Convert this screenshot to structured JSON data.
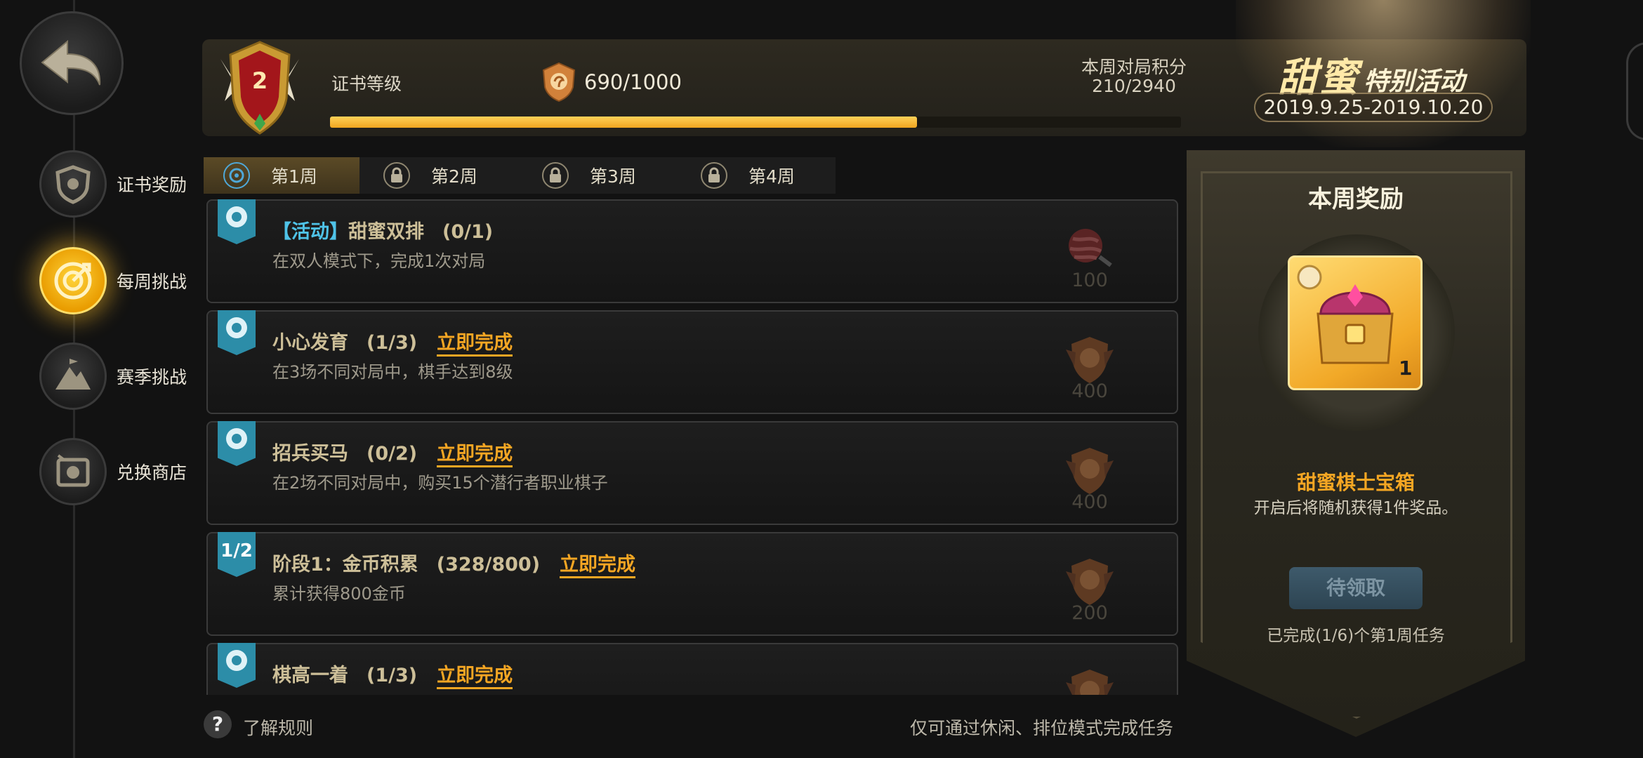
{
  "nav": {
    "items": [
      {
        "label": "证书奖励",
        "icon": "shield-icon"
      },
      {
        "label": "每周挑战",
        "icon": "target-icon",
        "active": true
      },
      {
        "label": "赛季挑战",
        "icon": "mountain-flag-icon"
      },
      {
        "label": "兑换商店",
        "icon": "shop-icon"
      }
    ]
  },
  "header": {
    "level": "2",
    "cert_label": "证书等级",
    "points": "690/1000",
    "points_progress": 0.69,
    "weekly_score_label": "本周对局积分",
    "weekly_score_value": "210/2940",
    "event_title_main": "甜蜜",
    "event_title_sub": "特别活动",
    "event_dates": "2019.9.25-2019.10.20"
  },
  "tabs": [
    {
      "label": "第1周",
      "state": "active",
      "icon": "target-icon"
    },
    {
      "label": "第2周",
      "state": "locked",
      "icon": "lock-icon"
    },
    {
      "label": "第3周",
      "state": "locked",
      "icon": "lock-icon"
    },
    {
      "label": "第4周",
      "state": "locked",
      "icon": "lock-icon"
    }
  ],
  "tasks": [
    {
      "prefix": "【活动】",
      "name": "甜蜜双排",
      "progress": "(0/1)",
      "action": "",
      "desc": "在双人模式下，完成1次对局",
      "reward": "100",
      "tag": "",
      "reward_icon": "candy-icon"
    },
    {
      "prefix": "",
      "name": "小心发育",
      "progress": "(1/3)",
      "action": "立即完成",
      "desc": "在3场不同对局中，棋手达到8级",
      "reward": "400",
      "tag": "",
      "reward_icon": "points-shield-icon"
    },
    {
      "prefix": "",
      "name": "招兵买马",
      "progress": "(0/2)",
      "action": "立即完成",
      "desc": "在2场不同对局中，购买15个潜行者职业棋子",
      "reward": "400",
      "tag": "",
      "reward_icon": "points-shield-icon"
    },
    {
      "prefix": "",
      "name": "阶段1：金币积累",
      "progress": "(328/800)",
      "action": "立即完成",
      "desc": "累计获得800金币",
      "reward": "200",
      "tag": "1/2",
      "reward_icon": "points-shield-icon"
    },
    {
      "prefix": "",
      "name": "棋高一着",
      "progress": "(1/3)",
      "action": "立即完成",
      "desc": "",
      "reward": "",
      "tag": "",
      "reward_icon": "points-shield-icon"
    }
  ],
  "reward_panel": {
    "title": "本周奖励",
    "item_count": "1",
    "item_name": "甜蜜棋士宝箱",
    "item_desc": "开启后将随机获得1件奖品。",
    "claim_label": "待领取",
    "completed_text": "已完成(1/6)个第1周任务"
  },
  "footer": {
    "help_icon": "?",
    "help_label": "了解规则",
    "note": "仅可通过休闲、排位模式完成任务"
  },
  "colors": {
    "accent_gold": "#f5a623",
    "task_tag": "#2c8da8",
    "highlight_blue": "#4fc3e8"
  }
}
